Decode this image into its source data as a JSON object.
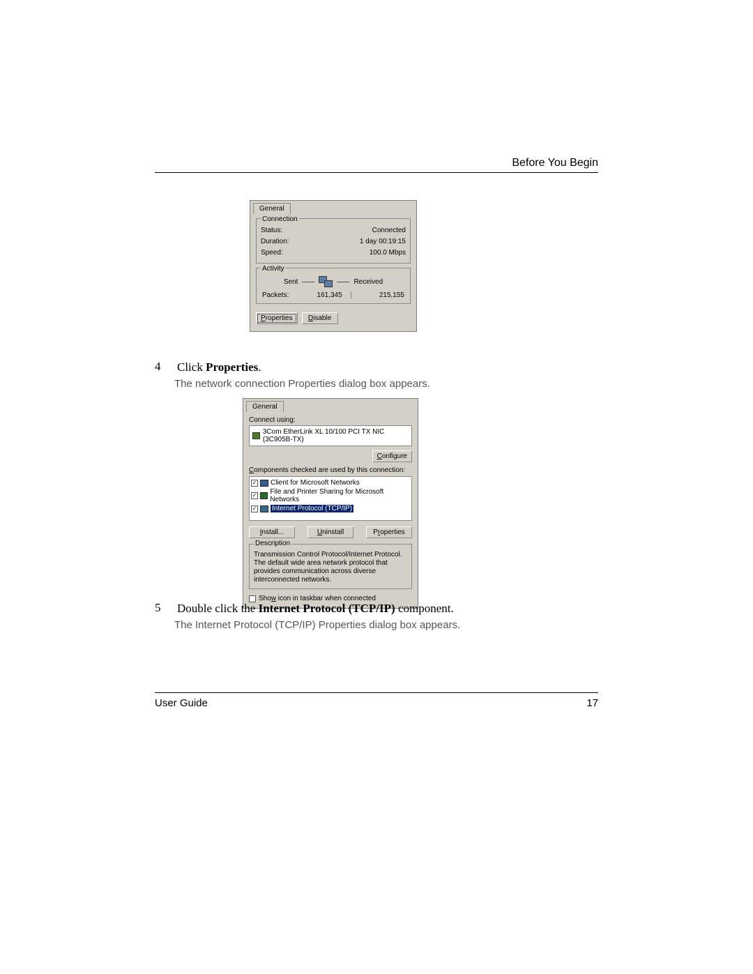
{
  "header": {
    "title": "Before You Begin"
  },
  "dialog1": {
    "tab": "General",
    "connection": {
      "legend": "Connection",
      "status_label": "Status:",
      "status_value": "Connected",
      "duration_label": "Duration:",
      "duration_value": "1 day 00:19:15",
      "speed_label": "Speed:",
      "speed_value": "100.0 Mbps"
    },
    "activity": {
      "legend": "Activity",
      "sent_label": "Sent",
      "received_label": "Received",
      "packets_label": "Packets:",
      "sent_value": "161,345",
      "received_value": "215,155"
    },
    "buttons": {
      "properties": "Properties",
      "disable": "Disable"
    }
  },
  "step4": {
    "num": "4",
    "text_prefix": "Click ",
    "bold": "Properties",
    "text_suffix": ".",
    "desc": "The network connection Properties dialog box appears."
  },
  "dialog2": {
    "tab": "General",
    "connect_using_label": "Connect using:",
    "nic_name": "3Com EtherLink XL 10/100 PCI TX NIC (3C905B-TX)",
    "configure_btn": "Configure",
    "components_label": "Components checked are used by this connection:",
    "items": {
      "client": "Client for Microsoft Networks",
      "fileshare": "File and Printer Sharing for Microsoft Networks",
      "tcpip": "Internet Protocol (TCP/IP)"
    },
    "buttons": {
      "install": "Install...",
      "uninstall": "Uninstall",
      "properties": "Properties"
    },
    "description": {
      "legend": "Description",
      "text": "Transmission Control Protocol/Internet Protocol. The default wide area network protocol that provides communication across diverse interconnected networks."
    },
    "show_icon": "Show icon in taskbar when connected"
  },
  "step5": {
    "num": "5",
    "text_prefix": "Double click the ",
    "bold": "Internet Protocol (TCP/IP)",
    "text_suffix": " component.",
    "desc": "The Internet Protocol (TCP/IP) Properties dialog box appears."
  },
  "footer": {
    "left": "User Guide",
    "right": "17"
  }
}
